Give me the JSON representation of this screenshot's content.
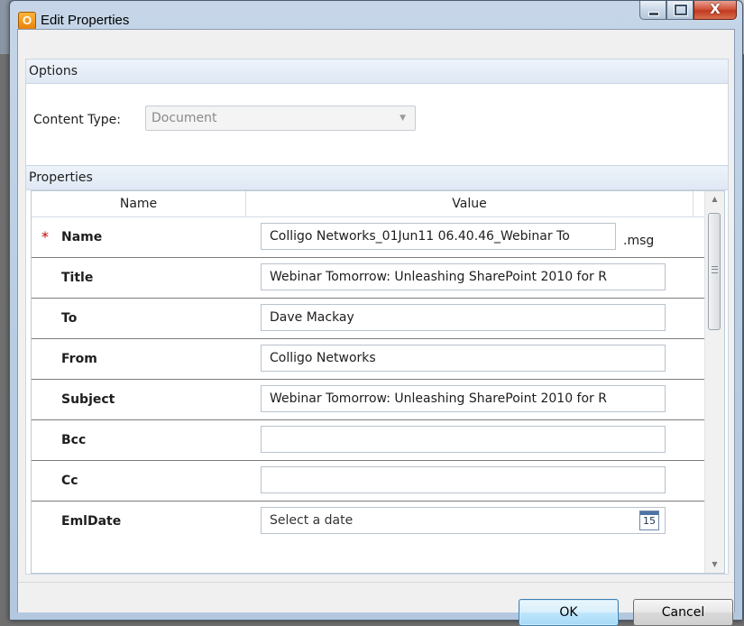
{
  "window": {
    "title": "Edit Properties",
    "app_icon_letter": "O",
    "buttons": {
      "minimize": "minimize",
      "maximize": "maximize",
      "close": "X"
    }
  },
  "options": {
    "header": "Options",
    "content_type_label": "Content Type:",
    "content_type_value": "Document"
  },
  "properties": {
    "header": "Properties",
    "columns": [
      "Name",
      "Value"
    ],
    "rows": [
      {
        "name": "Name",
        "required": "*",
        "value": "Colligo Networks_01Jun11 06.40.46_Webinar To",
        "suffix": ".msg"
      },
      {
        "name": "Title",
        "value": "Webinar Tomorrow: Unleashing SharePoint 2010 for R"
      },
      {
        "name": "To",
        "value": "Dave Mackay"
      },
      {
        "name": "From",
        "value": "Colligo Networks"
      },
      {
        "name": "Subject",
        "value": "Webinar Tomorrow: Unleashing SharePoint 2010 for R"
      },
      {
        "name": "Bcc",
        "value": ""
      },
      {
        "name": "Cc",
        "value": ""
      },
      {
        "name": "EmlDate",
        "value": "Select a date",
        "calendar_day": "15"
      }
    ]
  },
  "footer": {
    "ok_label": "OK",
    "cancel_label": "Cancel"
  },
  "colors": {
    "accent": "#3c7fb1",
    "required": "#c00000"
  }
}
